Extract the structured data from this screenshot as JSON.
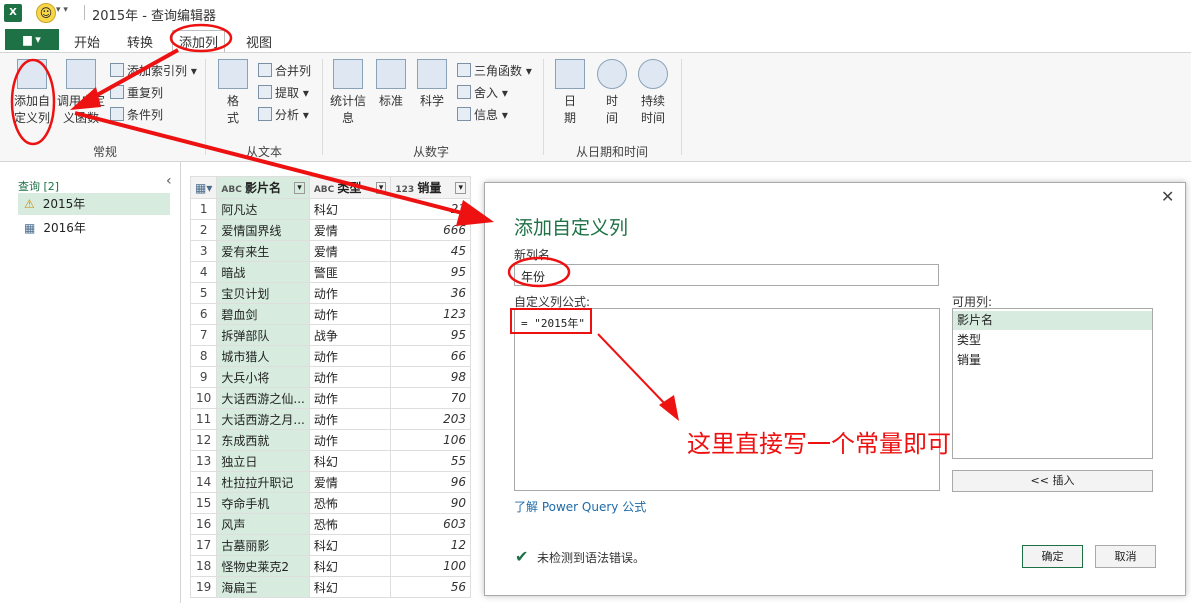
{
  "window": {
    "title": "2015年 - 查询编辑器",
    "app_icon": "X"
  },
  "tabs": {
    "file": "▆ ▾",
    "items": [
      "开始",
      "转换",
      "添加列",
      "视图"
    ]
  },
  "ribbon": {
    "groups": [
      {
        "label": "常规",
        "big": [
          "添加自定义列",
          "调用自定义函数"
        ],
        "small": [
          "添加索引列",
          "重复列",
          "条件列"
        ]
      },
      {
        "label": "从文本",
        "big": [
          "格式"
        ],
        "small": [
          "合并列",
          "提取",
          "分析"
        ]
      },
      {
        "label": "从数字",
        "big": [
          "统计信息",
          "标准",
          "科学"
        ],
        "small": [
          "三角函数",
          "舍入",
          "信息"
        ]
      },
      {
        "label": "从日期和时间",
        "big": [
          "日期",
          "时间",
          "持续时间"
        ]
      }
    ]
  },
  "queries": {
    "header": "查询 [2]",
    "items": [
      "2015年",
      "2016年"
    ]
  },
  "grid": {
    "columns": [
      "影片名",
      "类型",
      "销量"
    ],
    "rows": [
      [
        "1",
        "阿凡达",
        "科幻",
        "23"
      ],
      [
        "2",
        "爱情国界线",
        "爱情",
        "666"
      ],
      [
        "3",
        "爱有来生",
        "爱情",
        "45"
      ],
      [
        "4",
        "暗战",
        "警匪",
        "95"
      ],
      [
        "5",
        "宝贝计划",
        "动作",
        "36"
      ],
      [
        "6",
        "碧血剑",
        "动作",
        "123"
      ],
      [
        "7",
        "拆弹部队",
        "战争",
        "95"
      ],
      [
        "8",
        "城市猎人",
        "动作",
        "66"
      ],
      [
        "9",
        "大兵小将",
        "动作",
        "98"
      ],
      [
        "10",
        "大话西游之仙...",
        "动作",
        "70"
      ],
      [
        "11",
        "大话西游之月...",
        "动作",
        "203"
      ],
      [
        "12",
        "东成西就",
        "动作",
        "106"
      ],
      [
        "13",
        "独立日",
        "科幻",
        "55"
      ],
      [
        "14",
        "杜拉拉升职记",
        "爱情",
        "96"
      ],
      [
        "15",
        "夺命手机",
        "恐怖",
        "90"
      ],
      [
        "16",
        "风声",
        "恐怖",
        "603"
      ],
      [
        "17",
        "古墓丽影",
        "科幻",
        "12"
      ],
      [
        "18",
        "怪物史莱克2",
        "科幻",
        "100"
      ],
      [
        "19",
        "海扁王",
        "科幻",
        "56"
      ]
    ]
  },
  "dialog": {
    "title": "添加自定义列",
    "new_col_label": "新列名",
    "new_col_value": "年份",
    "formula_label": "自定义列公式:",
    "formula": "= \"2015年\"",
    "available_label": "可用列:",
    "available": [
      "影片名",
      "类型",
      "销量"
    ],
    "insert": "<< 插入",
    "learn_link": "了解 Power Query 公式",
    "status": "未检测到语法错误。",
    "ok": "确定",
    "cancel": "取消",
    "annotation": "这里直接写一个常量即可"
  },
  "colors": {
    "accent": "#1e7145",
    "annotation": "#e11111",
    "selected_row": "#d7ecdf"
  }
}
